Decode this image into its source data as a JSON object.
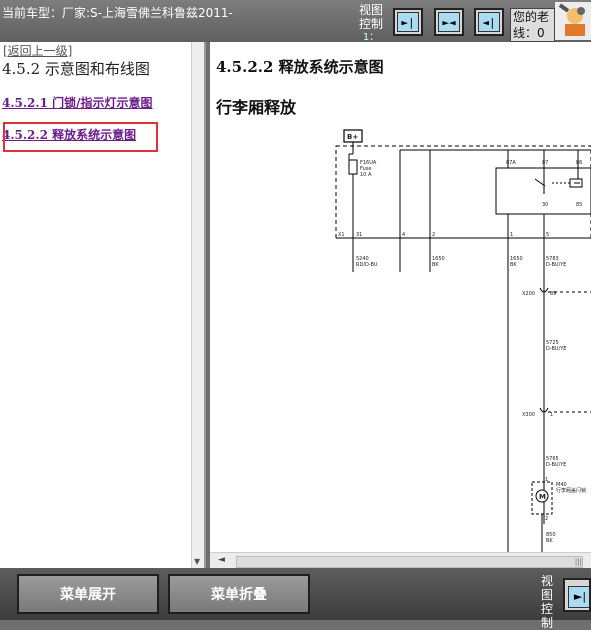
{
  "header": {
    "car_model": "当前车型：厂家:S-上海雪佛兰科鲁兹2011-",
    "view_control_line1": "视图",
    "view_control_line2": "控制",
    "view_control_line3": "1：",
    "nav_buttons": [
      "►|",
      "►◄",
      "◄|"
    ],
    "greeting_line1": "您的老",
    "greeting_line2": "线：0"
  },
  "left": {
    "back_link": "[返回上一级]",
    "section_title": "4.5.2 示意图和布线图",
    "links": [
      {
        "label": "4.5.2.1 门锁/指示灯示意图"
      },
      {
        "label": "4.5.2.2 释放系统示意图"
      }
    ]
  },
  "right": {
    "title": "4.5.2.2 释放系统示意图",
    "subtitle": "行李厢释放"
  },
  "diagram": {
    "power_label": "B+",
    "fuse_name": "F16UA",
    "fuse_type": "Fuse",
    "fuse_rating": "10 A",
    "relay_pins": [
      "87A",
      "87",
      "30",
      "85",
      "86"
    ],
    "connector": "X1",
    "connector_pins": [
      "31",
      "4",
      "2",
      "1",
      "5"
    ],
    "wires": [
      {
        "code": "5240",
        "color": "RD/D-BU"
      },
      {
        "code": "1650",
        "color": "BK"
      },
      {
        "code": "1650",
        "color": "BK"
      },
      {
        "code": "5783",
        "color": "D-BU/YE"
      }
    ],
    "splice_1": "X200",
    "splice_1_pin": "89",
    "wire_2": {
      "code": "5725",
      "color": "D-BU/YE"
    },
    "splice_2": "X300",
    "splice_2_pin": "1",
    "wire_3": {
      "code": "5765",
      "color": "D-BU/YE"
    },
    "motor_id": "M40",
    "motor_name": "行李厢盖闩锁",
    "motor_pins": [
      "1",
      "2"
    ],
    "wire_4": {
      "code": "850",
      "color": "BK"
    }
  },
  "bottom": {
    "expand_label": "菜单展开",
    "collapse_label": "菜单折叠",
    "view_control": [
      "视",
      "图",
      "控",
      "制"
    ],
    "nav_button": "►|"
  }
}
